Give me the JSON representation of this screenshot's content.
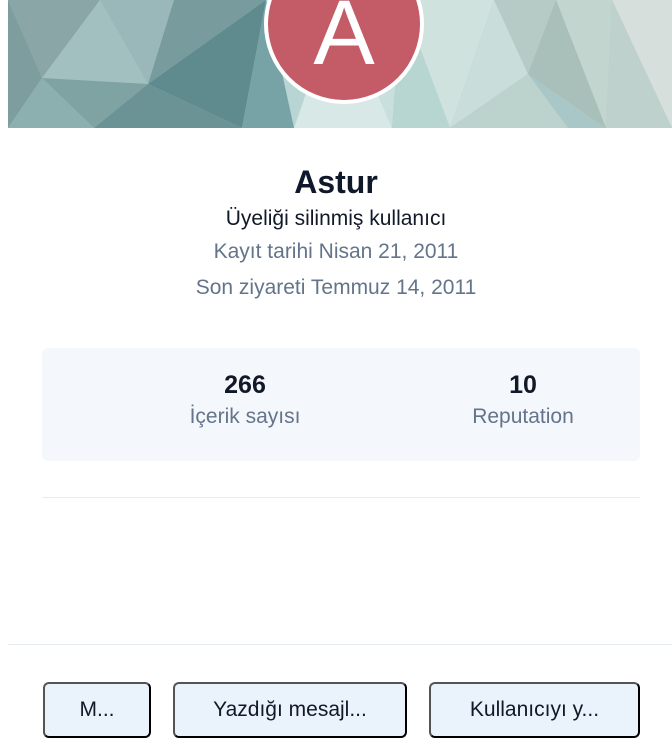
{
  "cover": {
    "avatar_letter": "A",
    "avatar_color": "#c45c67"
  },
  "profile": {
    "name": "Astur",
    "group": "Üyeliği silinmiş kullanıcı",
    "joined": "Kayıt tarihi Nisan 21, 2011",
    "last_visit": "Son ziyareti Temmuz 14, 2011"
  },
  "stats": [
    {
      "value": "266",
      "label": "İçerik sayısı"
    },
    {
      "value": "10",
      "label": "Reputation"
    }
  ],
  "actions": {
    "message_label": "M...",
    "posts_label": "Yazdığı mesajl...",
    "user_label": "Kullanıcıyı y..."
  },
  "colors": {
    "primary_text": "#111827",
    "muted_text": "#64748b",
    "stats_background": "#f4f7fb",
    "button_background": "#eaf2fb"
  }
}
